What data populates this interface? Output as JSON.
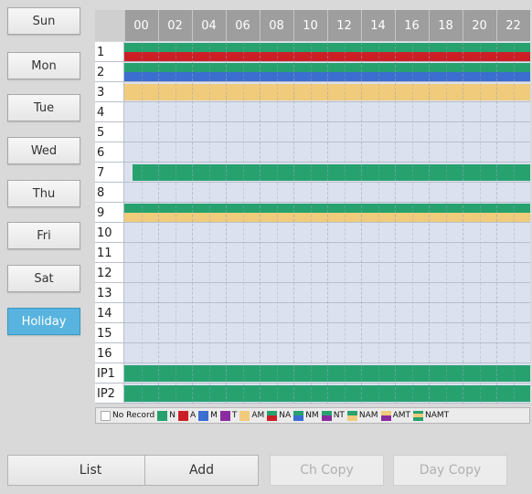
{
  "days": [
    {
      "label": "Sun",
      "active": false
    },
    {
      "label": "Mon",
      "active": false
    },
    {
      "label": "Tue",
      "active": false
    },
    {
      "label": "Wed",
      "active": false
    },
    {
      "label": "Thu",
      "active": false
    },
    {
      "label": "Fri",
      "active": false
    },
    {
      "label": "Sat",
      "active": false
    },
    {
      "label": "Holiday",
      "active": true
    }
  ],
  "hours": [
    "00",
    "02",
    "04",
    "06",
    "08",
    "10",
    "12",
    "14",
    "16",
    "18",
    "20",
    "22"
  ],
  "channels": [
    {
      "label": "1",
      "segments": [
        {
          "type": "N",
          "from": 0,
          "to": 24
        },
        {
          "type": "A",
          "from": 0,
          "to": 24
        }
      ]
    },
    {
      "label": "2",
      "segments": [
        {
          "type": "N",
          "from": 0,
          "to": 24
        },
        {
          "type": "M",
          "from": 0,
          "to": 24
        }
      ]
    },
    {
      "label": "3",
      "segments": [
        {
          "type": "AM",
          "from": 0,
          "to": 24
        }
      ]
    },
    {
      "label": "4",
      "segments": []
    },
    {
      "label": "5",
      "segments": []
    },
    {
      "label": "6",
      "segments": []
    },
    {
      "label": "7",
      "segments": [
        {
          "type": "N",
          "from": 0.5,
          "to": 24
        }
      ]
    },
    {
      "label": "8",
      "segments": []
    },
    {
      "label": "9",
      "segments": [
        {
          "type": "N",
          "from": 0,
          "to": 24
        },
        {
          "type": "AM",
          "from": 0,
          "to": 24
        }
      ]
    },
    {
      "label": "10",
      "segments": []
    },
    {
      "label": "11",
      "segments": []
    },
    {
      "label": "12",
      "segments": []
    },
    {
      "label": "13",
      "segments": []
    },
    {
      "label": "14",
      "segments": []
    },
    {
      "label": "15",
      "segments": []
    },
    {
      "label": "16",
      "segments": []
    },
    {
      "label": "IP1",
      "segments": [
        {
          "type": "N",
          "from": 0,
          "to": 24
        }
      ]
    },
    {
      "label": "IP2",
      "segments": [
        {
          "type": "N",
          "from": 0,
          "to": 24
        }
      ]
    }
  ],
  "legend": [
    {
      "label": "No Record",
      "colors": [
        "#ffffff"
      ]
    },
    {
      "label": "N",
      "colors": [
        "#27a26f"
      ]
    },
    {
      "label": "A",
      "colors": [
        "#cc1f25"
      ]
    },
    {
      "label": "M",
      "colors": [
        "#3b6ed0"
      ]
    },
    {
      "label": "T",
      "colors": [
        "#8a2ca0"
      ]
    },
    {
      "label": "AM",
      "colors": [
        "#f0cb7b"
      ]
    },
    {
      "label": "NA",
      "colors": [
        "#27a26f",
        "#cc1f25"
      ]
    },
    {
      "label": "NM",
      "colors": [
        "#27a26f",
        "#3b6ed0"
      ]
    },
    {
      "label": "NT",
      "colors": [
        "#27a26f",
        "#8a2ca0"
      ]
    },
    {
      "label": "NAM",
      "colors": [
        "#27a26f",
        "#f0cb7b"
      ]
    },
    {
      "label": "AMT",
      "colors": [
        "#f0cb7b",
        "#8a2ca0"
      ]
    },
    {
      "label": "NAMT",
      "colors": [
        "#27a26f",
        "#f0cb7b",
        "#27a26f"
      ]
    }
  ],
  "colors": {
    "N": "#27a26f",
    "A": "#cc1f25",
    "M": "#3b6ed0",
    "T": "#8a2ca0",
    "AM": "#f0cb7b",
    "empty_row": "#dbe1ef",
    "header": "#9e9e9e",
    "accent": "#58b4df"
  },
  "buttons": [
    {
      "label": "List",
      "enabled": true
    },
    {
      "label": "Add",
      "enabled": true
    },
    {
      "label": "Ch Copy",
      "enabled": false
    },
    {
      "label": "Day Copy",
      "enabled": false
    }
  ]
}
